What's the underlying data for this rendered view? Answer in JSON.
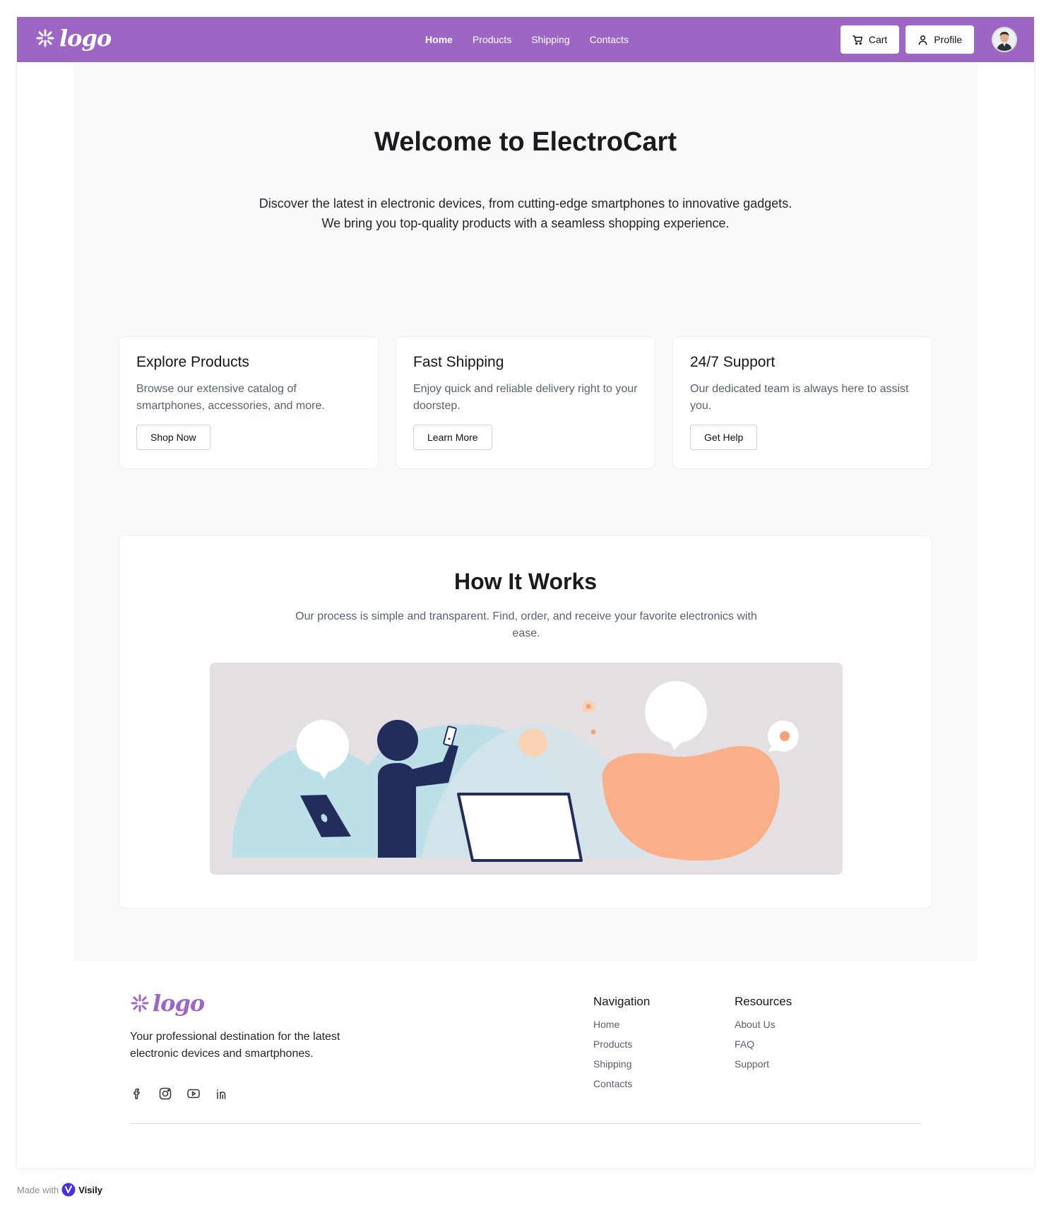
{
  "header": {
    "logo_text": "logo",
    "nav": [
      {
        "label": "Home",
        "active": true
      },
      {
        "label": "Products",
        "active": false
      },
      {
        "label": "Shipping",
        "active": false
      },
      {
        "label": "Contacts",
        "active": false
      }
    ],
    "cart_label": "Cart",
    "profile_label": "Profile"
  },
  "hero": {
    "title": "Welcome to ElectroCart",
    "line1": "Discover the latest in electronic devices, from cutting-edge smartphones to innovative gadgets.",
    "line2": "We bring you top-quality products with a seamless shopping experience."
  },
  "cards": [
    {
      "title": "Explore Products",
      "text": "Browse our extensive catalog of smartphones, accessories, and more.",
      "button": "Shop Now"
    },
    {
      "title": "Fast Shipping",
      "text": "Enjoy quick and reliable delivery right to your doorstep.",
      "button": "Learn More"
    },
    {
      "title": "24/7 Support",
      "text": "Our dedicated team is always here to assist you.",
      "button": "Get Help"
    }
  ],
  "how": {
    "title": "How It Works",
    "text": "Our process is simple and transparent. Find, order, and receive your favorite electronics with ease."
  },
  "footer": {
    "logo_text": "logo",
    "description": "Your professional destination for the latest electronic devices and smartphones.",
    "socials": [
      "facebook-icon",
      "instagram-icon",
      "youtube-icon",
      "linkedin-icon"
    ],
    "navigation": {
      "title": "Navigation",
      "links": [
        "Home",
        "Products",
        "Shipping",
        "Contacts"
      ]
    },
    "resources": {
      "title": "Resources",
      "links": [
        "About Us",
        "FAQ",
        "Support"
      ]
    }
  },
  "made_with": {
    "prefix": "Made with",
    "brand": "Visily"
  },
  "colors": {
    "brand": "#9e66c4",
    "page_bg": "#f9f9f9",
    "navy": "#232d5c",
    "peach": "#f9b08a",
    "light_blue": "#bde0e8"
  }
}
